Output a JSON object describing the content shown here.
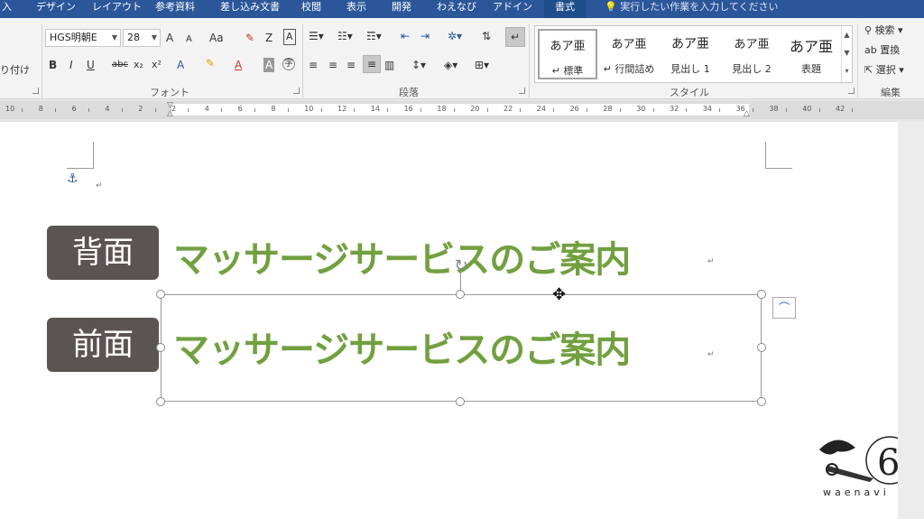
{
  "ribbon_tabs": [
    "入",
    "デザイン",
    "レイアウト",
    "参考資料",
    "差し込み文書",
    "校閲",
    "表示",
    "開発",
    "わえなび",
    "アドイン",
    "書式"
  ],
  "active_tab": "書式",
  "tell_me": "実行したい作業を入力してください",
  "clipboard": {
    "paste_label": "り付け"
  },
  "font": {
    "name": "HGS明朝E",
    "size": "28",
    "group_label": "フォント",
    "grow": "A",
    "shrink": "A",
    "case": "Aa",
    "bold": "B",
    "italic": "I",
    "underline": "U",
    "strike": "abc",
    "subscript": "x₂",
    "superscript": "x²",
    "effects": "A",
    "font_color": "A",
    "char_shade": "A",
    "enclose": "字"
  },
  "paragraph": {
    "group_label": "段落"
  },
  "styles": {
    "group_label": "スタイル",
    "items": [
      {
        "preview": "あア亜",
        "name": "↵ 標準",
        "selected": true
      },
      {
        "preview": "あア亜",
        "name": "↵ 行間詰め",
        "selected": false
      },
      {
        "preview": "あア亜",
        "name": "見出し 1",
        "selected": false
      },
      {
        "preview": "あア亜",
        "name": "見出し 2",
        "selected": false
      },
      {
        "preview": "あア亜",
        "name": "表題",
        "selected": false
      }
    ]
  },
  "editing": {
    "group_label": "編集",
    "search": "検索",
    "replace": "置換",
    "select": "選択"
  },
  "ruler": {
    "numbers": [
      "10",
      "8",
      "6",
      "4",
      "2",
      "2",
      "4",
      "6",
      "8",
      "10",
      "12",
      "14",
      "16",
      "18",
      "20",
      "22",
      "24",
      "26",
      "28",
      "30",
      "32",
      "34",
      "36",
      "38",
      "40",
      "42"
    ]
  },
  "document": {
    "back_label": "背面",
    "front_label": "前面",
    "back_text": "マッサージサービスのご案内",
    "front_text": "マッサージサービスのご案内",
    "para_mark": "↵"
  },
  "watermark": {
    "text": "waenavi"
  },
  "colors": {
    "ribbon_blue": "#2b579a",
    "headline_green": "#72a040",
    "badge_gray": "#5a5552"
  }
}
